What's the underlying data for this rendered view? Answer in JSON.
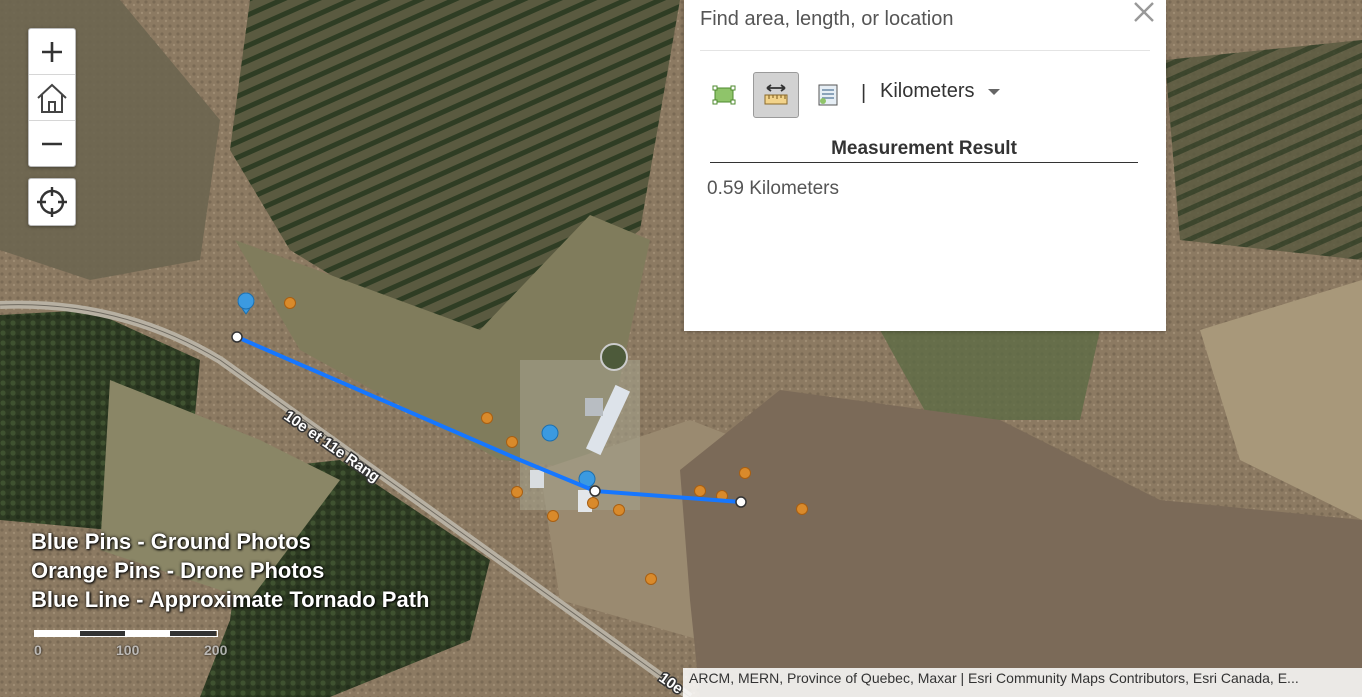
{
  "map": {
    "road_label": "10e et 11e Rang",
    "road_label_2": "10e",
    "pin_colors": {
      "ground": "#3b9ae1",
      "drone": "#d98a2b",
      "path": "#1677ff"
    },
    "measurement_path_vertices": 3
  },
  "controls": {
    "zoom_in_icon": "plus-icon",
    "home_icon": "home-icon",
    "zoom_out_icon": "minus-icon",
    "locate_icon": "crosshair-icon"
  },
  "panel": {
    "search_placeholder": "Find area, length, or location",
    "close_icon": "close-icon",
    "tools": [
      {
        "name": "area",
        "icon": "area-measure-icon",
        "active": false
      },
      {
        "name": "distance",
        "icon": "distance-measure-icon",
        "active": true
      },
      {
        "name": "location",
        "icon": "location-measure-icon",
        "active": false
      }
    ],
    "separator": "|",
    "unit": "Kilometers",
    "result_heading": "Measurement Result",
    "result_value": "0.59 Kilometers"
  },
  "legend": {
    "line1": "Blue Pins - Ground Photos",
    "line2": "Orange Pins - Drone Photos",
    "line3": "Blue Line - Approximate Tornado Path"
  },
  "scalebar": {
    "label_0": "0",
    "label_100": "100",
    "label_200": "200"
  },
  "attribution": "ARCM, MERN, Province of Quebec, Maxar | Esri Community Maps Contributors, Esri Canada, E..."
}
